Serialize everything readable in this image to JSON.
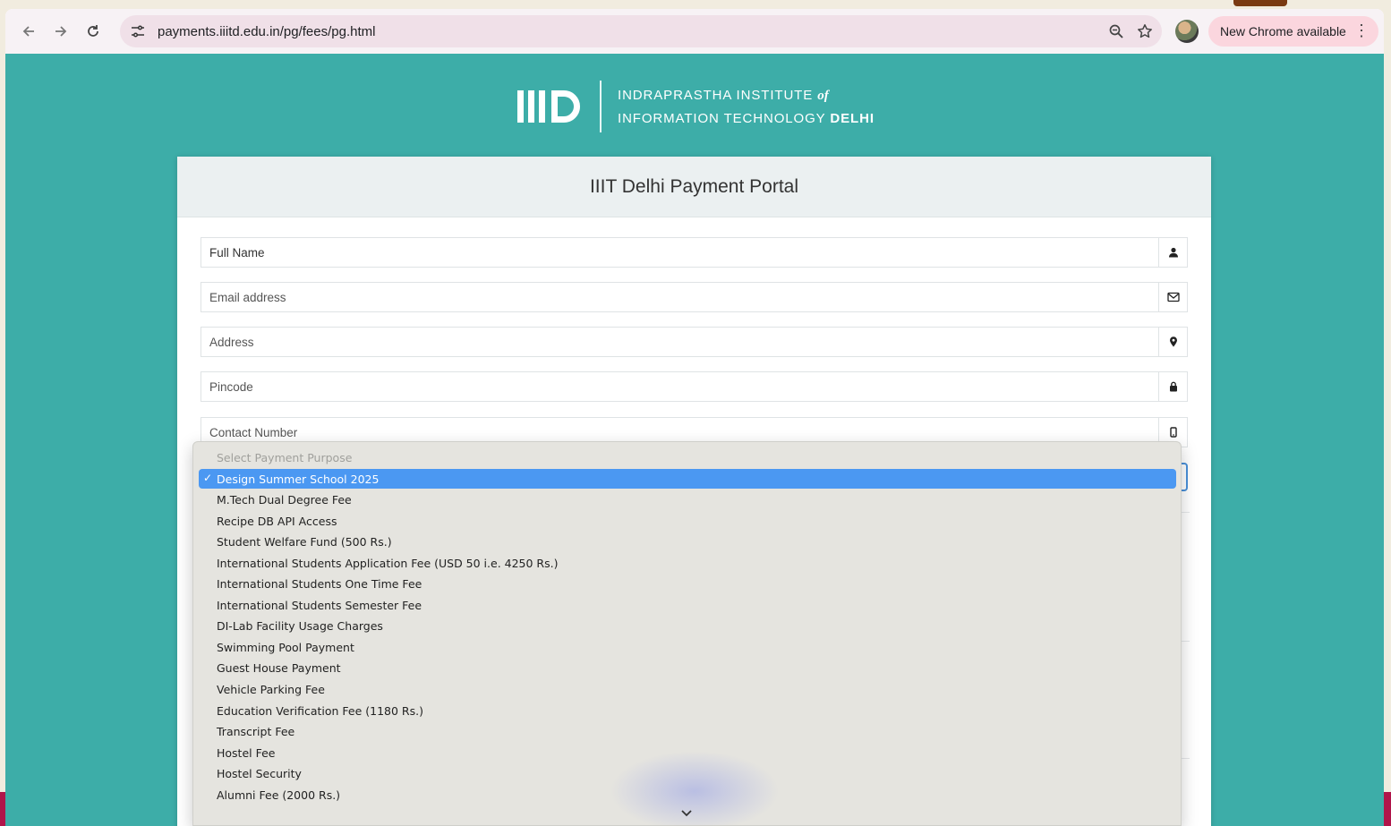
{
  "browser": {
    "url": "payments.iiitd.edu.in/pg/fees/pg.html",
    "update_label": "New Chrome available"
  },
  "header": {
    "logo_line1": "INDRAPRASTHA INSTITUTE",
    "logo_of": "of",
    "logo_line2": "INFORMATION TECHNOLOGY",
    "logo_city": "DELHI"
  },
  "form": {
    "title": "IIIT Delhi Payment Portal",
    "fields": [
      {
        "placeholder": "Full Name",
        "icon": "user-icon"
      },
      {
        "placeholder": "Email address",
        "icon": "envelope-icon"
      },
      {
        "placeholder": "Address",
        "icon": "map-marker-icon"
      },
      {
        "placeholder": "Pincode",
        "icon": "lock-icon"
      },
      {
        "placeholder": "Contact Number",
        "icon": "mobile-icon"
      }
    ]
  },
  "dropdown": {
    "header": "Select Payment Purpose",
    "selected_index": 0,
    "options": [
      "Design Summer School 2025",
      "M.Tech Dual Degree Fee",
      "Recipe DB API Access",
      "Student Welfare Fund (500 Rs.)",
      "International Students Application Fee (USD 50 i.e. 4250 Rs.)",
      "International Students One Time Fee",
      "International Students Semester Fee",
      "DI-Lab Facility Usage Charges",
      "Swimming Pool Payment",
      "Guest House Payment",
      "Vehicle Parking Fee",
      "Education Verification Fee (1180 Rs.)",
      "Transcript Fee",
      "Hostel Fee",
      "Hostel Security",
      "Alumni Fee (2000 Rs.)"
    ]
  },
  "colors": {
    "page_bg": "#3dada8",
    "selected_option": "#4b98f2"
  }
}
